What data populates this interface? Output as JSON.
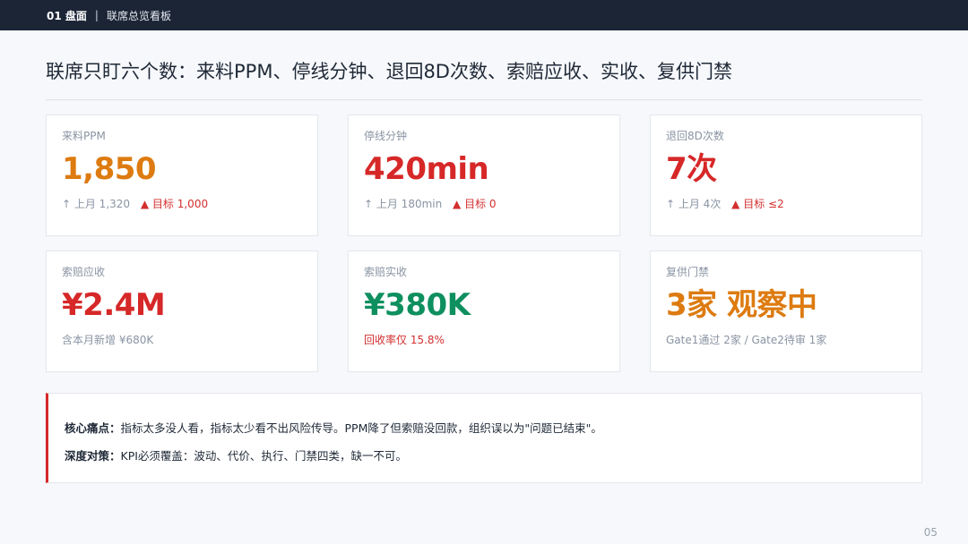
{
  "topbar": {
    "section": "01 盘面",
    "separator": "|",
    "crumb": "联席总览看板"
  },
  "headline": "联席只盯六个数：来料PPM、停线分钟、退回8D次数、索赔应收、实收、复供门禁",
  "colors": {
    "orange": "#dd7b10",
    "red": "#d62828",
    "green": "#0e8f5f",
    "accent_bar": "#d62828",
    "topbar": "#1c2536"
  },
  "cards": [
    {
      "label": "来料PPM",
      "value": "1,850",
      "color": "orange",
      "trend": "↑ 上月 1,320",
      "target": "▲ 目标 1,000"
    },
    {
      "label": "停线分钟",
      "value": "420min",
      "color": "red",
      "trend": "↑ 上月 180min",
      "target": "▲ 目标 0"
    },
    {
      "label": "退回8D次数",
      "value": "7次",
      "color": "red",
      "trend": "↑ 上月 4次",
      "target": "▲ 目标 ≤2"
    },
    {
      "label": "索赔应收",
      "value": "¥2.4M",
      "color": "red",
      "sub": "含本月新增 ¥680K"
    },
    {
      "label": "索赔实收",
      "value": "¥380K",
      "color": "green",
      "sub": "回收率仅 15.8%"
    },
    {
      "label": "复供门禁",
      "value": "3家 观察中",
      "color": "orange",
      "sub": "Gate1通过 2家 / Gate2待审 1家"
    }
  ],
  "note": {
    "pain_key": "核心痛点：",
    "pain_text": "指标太多没人看，指标太少看不出风险传导。PPM降了但索赔没回款，组织误以为\"问题已结束\"。",
    "fix_key": "深度对策：",
    "fix_text": "KPI必须覆盖：波动、代价、执行、门禁四类，缺一不可。"
  },
  "page_number": "05"
}
